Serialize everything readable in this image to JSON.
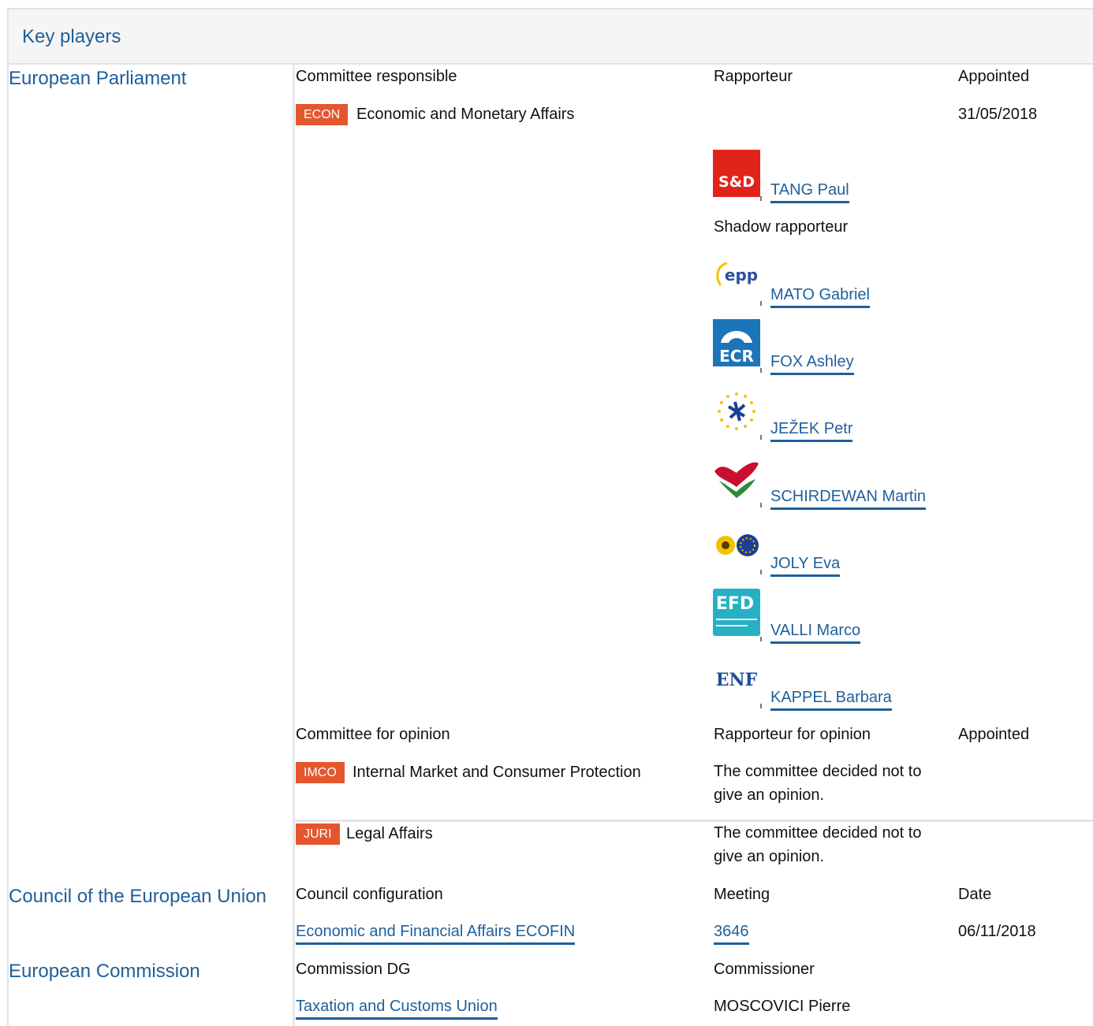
{
  "header": {
    "title": "Key players"
  },
  "ep": {
    "title": "European Parliament",
    "committee_header": "Committee responsible",
    "rapporteur_header": "Rapporteur",
    "appointed_header": "Appointed",
    "responsible": {
      "code": "ECON",
      "name": "Economic and Monetary Affairs",
      "date": "31/05/2018"
    },
    "rapporteur": {
      "group": "S&D",
      "name": "TANG Paul"
    },
    "shadow_header": "Shadow rapporteur",
    "shadows": [
      {
        "group": "epp",
        "name": "MATO Gabriel"
      },
      {
        "group": "ECR",
        "name": "FOX Ashley"
      },
      {
        "group": "renew",
        "name": "JEŽEK Petr"
      },
      {
        "group": "gue",
        "name": "SCHIRDEWAN Martin"
      },
      {
        "group": "greens",
        "name": "JOLY Eva"
      },
      {
        "group": "EFD",
        "name": "VALLI Marco"
      },
      {
        "group": "ENF",
        "name": "KAPPEL Barbara"
      }
    ],
    "opinion_header": "Committee for opinion",
    "opinion_rapporteur_header": "Rapporteur for opinion",
    "opinion_appointed_header": "Appointed",
    "opinions": [
      {
        "code": "IMCO",
        "name": "Internal Market and Consumer Protection",
        "note_line1": "The committee decided not to",
        "note_line2": "give an opinion."
      },
      {
        "code": "JURI",
        "name": "Legal Affairs",
        "note_line1": "The committee decided not to",
        "note_line2": "give an opinion."
      }
    ]
  },
  "council": {
    "title": "Council of the European Union",
    "config_header": "Council configuration",
    "meeting_header": "Meeting",
    "date_header": "Date",
    "config": "Economic and Financial Affairs ECOFIN",
    "meeting": "3646",
    "date": "06/11/2018"
  },
  "commission": {
    "title": "European Commission",
    "dg_header": "Commission DG",
    "commissioner_header": "Commissioner",
    "dg": "Taxation and Customs Union",
    "commissioner": "MOSCOVICI Pierre"
  }
}
